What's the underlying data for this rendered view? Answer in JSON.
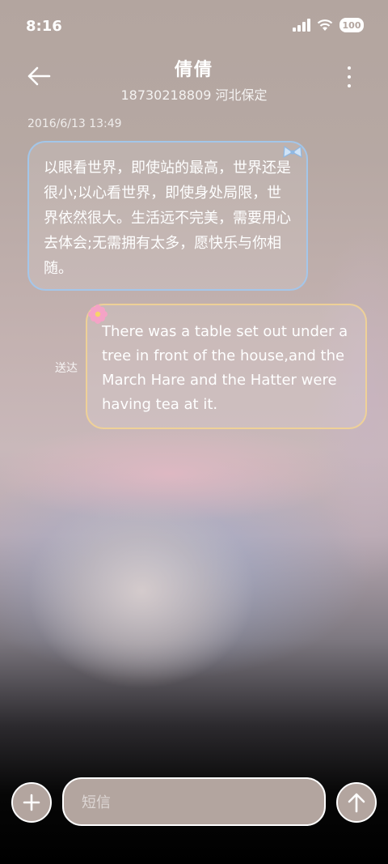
{
  "status_bar": {
    "time": "8:16",
    "battery_label": "100",
    "icons": [
      "signal-icon",
      "wifi-icon",
      "battery-icon"
    ]
  },
  "header": {
    "contact_name": "倩倩",
    "contact_subtitle": "18730218809 河北保定",
    "icons": [
      "back-arrow-icon",
      "more-vertical-icon"
    ]
  },
  "conversation": {
    "timestamp": "2016/6/13 13:49",
    "messages": [
      {
        "direction": "incoming",
        "text": "以眼看世界，即使站的最高，世界还是很小;以心看世界，即使身处局限，世界依然很大。生活远不完美，需要用心去体会;无需拥有太多，愿快乐与你相随。",
        "decoration_icon": "bow-icon",
        "border_color": "#a0c8f0"
      },
      {
        "direction": "outgoing",
        "text": "There was a table set out under a tree in front of the house,and the March Hare and the Hatter were having tea at it.",
        "status": "送达",
        "decoration_icon": "flower-icon",
        "border_color": "#f0d296"
      }
    ]
  },
  "composer": {
    "placeholder": "短信",
    "icons": [
      "plus-icon",
      "send-arrow-icon"
    ]
  },
  "colors": {
    "text": "#ffffff",
    "input_background": "#b3a59f"
  }
}
